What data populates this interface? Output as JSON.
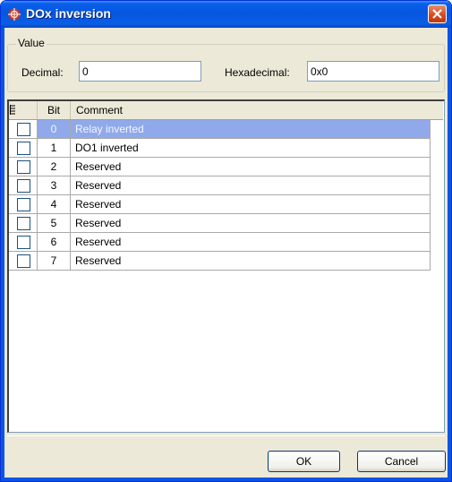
{
  "window": {
    "title": "DOx inversion"
  },
  "value_group": {
    "title": "Value",
    "decimal_label": "Decimal:",
    "decimal_value": "0",
    "hex_label": "Hexadecimal:",
    "hex_value": "0x0"
  },
  "grid": {
    "columns": [
      "Bit",
      "Comment"
    ],
    "rows": [
      {
        "bit": "0",
        "comment": "Relay inverted",
        "checked": false,
        "selected": true
      },
      {
        "bit": "1",
        "comment": "DO1 inverted",
        "checked": false,
        "selected": false
      },
      {
        "bit": "2",
        "comment": "Reserved",
        "checked": false,
        "selected": false
      },
      {
        "bit": "3",
        "comment": "Reserved",
        "checked": false,
        "selected": false
      },
      {
        "bit": "4",
        "comment": "Reserved",
        "checked": false,
        "selected": false
      },
      {
        "bit": "5",
        "comment": "Reserved",
        "checked": false,
        "selected": false
      },
      {
        "bit": "6",
        "comment": "Reserved",
        "checked": false,
        "selected": false
      },
      {
        "bit": "7",
        "comment": "Reserved",
        "checked": false,
        "selected": false
      }
    ]
  },
  "buttons": {
    "ok": "OK",
    "cancel": "Cancel"
  },
  "colors": {
    "selection": "#8fa9ea",
    "titlebar": "#0556df",
    "close": "#d5481e"
  }
}
